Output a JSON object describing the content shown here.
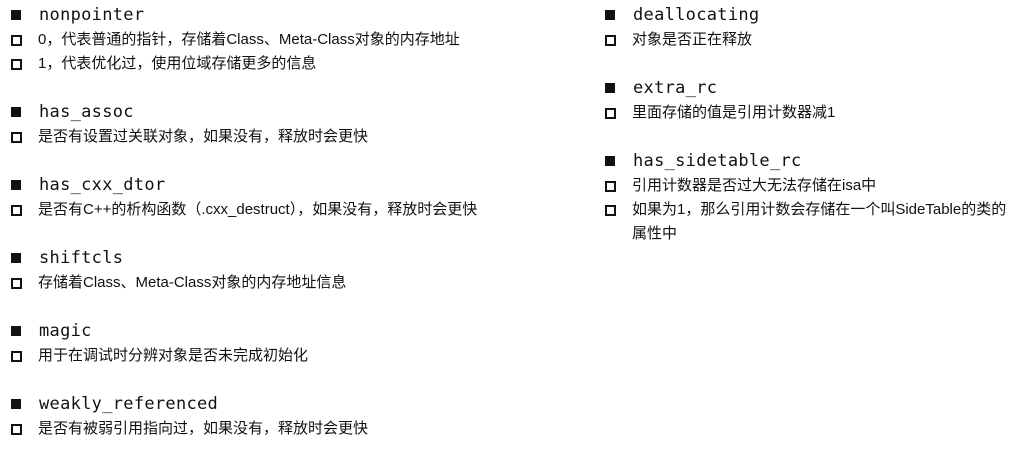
{
  "left_sections": [
    {
      "heading": "nonpointer",
      "items": [
        "0，代表普通的指针，存储着Class、Meta-Class对象的内存地址",
        "1，代表优化过，使用位域存储更多的信息"
      ]
    },
    {
      "heading": "has_assoc",
      "items": [
        "是否有设置过关联对象，如果没有，释放时会更快"
      ]
    },
    {
      "heading": "has_cxx_dtor",
      "items": [
        "是否有C++的析构函数（.cxx_destruct），如果没有，释放时会更快"
      ]
    },
    {
      "heading": "shiftcls",
      "items": [
        "存储着Class、Meta-Class对象的内存地址信息"
      ]
    },
    {
      "heading": "magic",
      "items": [
        "用于在调试时分辨对象是否未完成初始化"
      ]
    },
    {
      "heading": "weakly_referenced",
      "items": [
        "是否有被弱引用指向过，如果没有，释放时会更快"
      ]
    }
  ],
  "right_sections": [
    {
      "heading": "deallocating",
      "items": [
        "对象是否正在释放"
      ]
    },
    {
      "heading": "extra_rc",
      "items": [
        "里面存储的值是引用计数器减1"
      ]
    },
    {
      "heading": "has_sidetable_rc",
      "items": [
        "引用计数器是否过大无法存储在isa中",
        "如果为1，那么引用计数会存储在一个叫SideTable的类的属性中"
      ]
    }
  ]
}
